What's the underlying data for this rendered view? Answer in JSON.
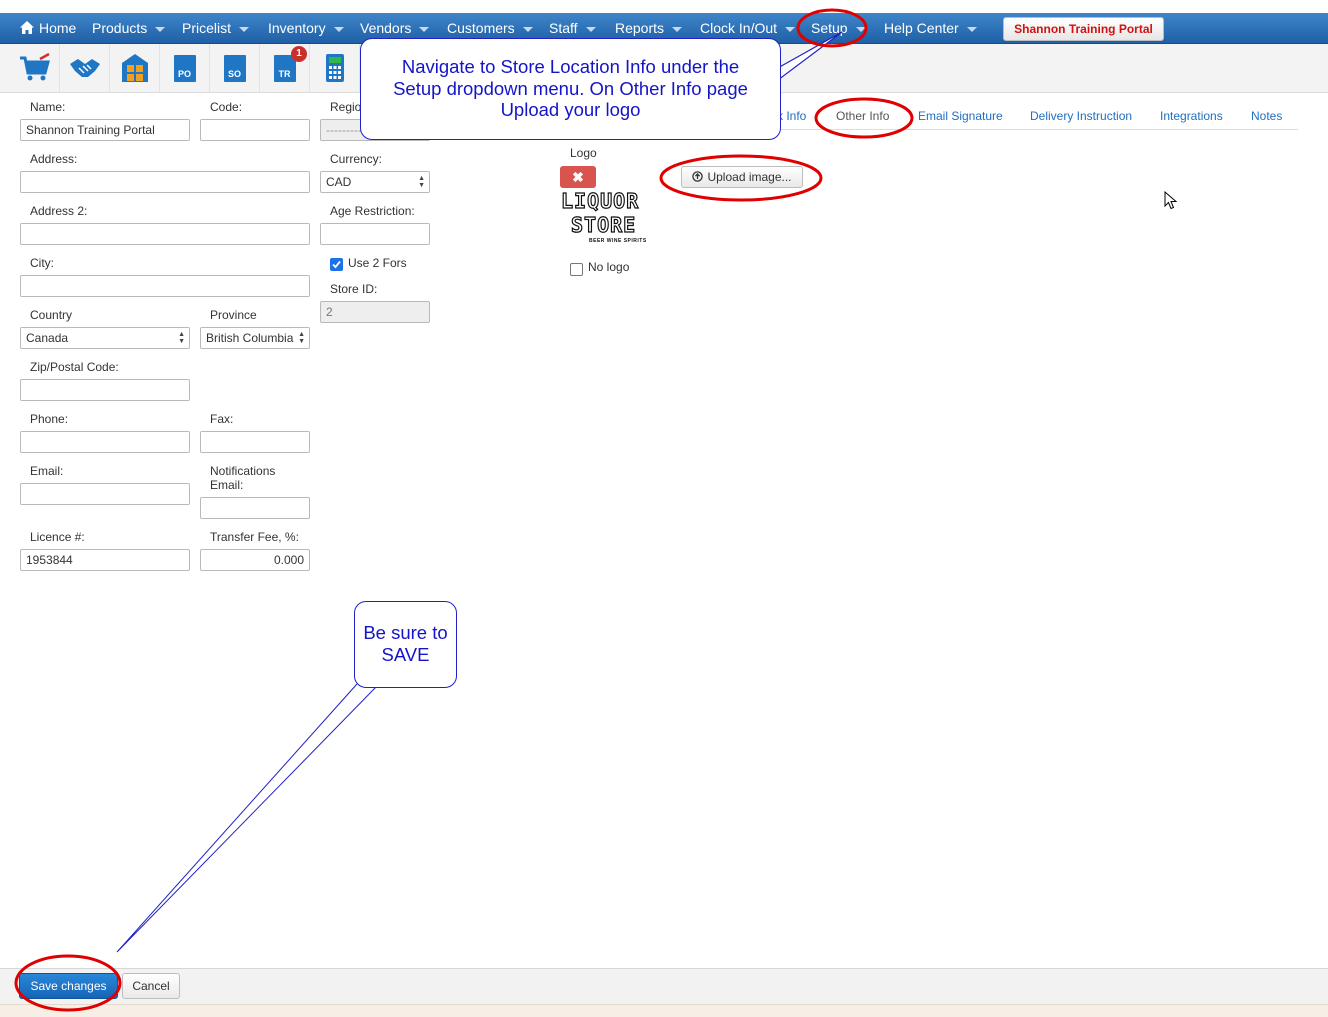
{
  "nav": {
    "home": "Home",
    "products": "Products",
    "pricelist": "Pricelist",
    "inventory": "Inventory",
    "vendors": "Vendors",
    "customers": "Customers",
    "staff": "Staff",
    "reports": "Reports",
    "clock": "Clock In/Out",
    "setup": "Setup",
    "help": "Help Center",
    "portal": "Shannon Training Portal"
  },
  "toolbar": {
    "tools": [
      "shopping-cart-icon",
      "handshake-icon",
      "store-grid-icon",
      "po-icon",
      "so-icon",
      "tr-icon",
      "calculator-icon"
    ],
    "po_label": "PO",
    "so_label": "SO",
    "tr_label": "TR",
    "tr_badge": "1"
  },
  "form": {
    "name_label": "Name:",
    "name_value": "Shannon Training Portal",
    "code_label": "Code:",
    "code_value": "",
    "region_label": "Regio",
    "region_value": "---------",
    "address_label": "Address:",
    "address_value": "",
    "currency_label": "Currency:",
    "currency_value": "CAD",
    "address2_label": "Address 2:",
    "address2_value": "",
    "age_label": "Age Restriction:",
    "age_value": "",
    "city_label": "City:",
    "city_value": "",
    "use2fors_label": "Use 2 Fors",
    "use2fors_checked": true,
    "storeid_label": "Store ID:",
    "storeid_value": "2",
    "country_label": "Country",
    "country_value": "Canada",
    "province_label": "Province",
    "province_value": "British Columbia",
    "zip_label": "Zip/Postal Code:",
    "zip_value": "",
    "phone_label": "Phone:",
    "phone_value": "",
    "fax_label": "Fax:",
    "fax_value": "",
    "email_label": "Email:",
    "email_value": "",
    "notif_label1": "Notifications",
    "notif_label2": "Email:",
    "notif_value": "",
    "licence_label": "Licence #:",
    "licence_value": "1953844",
    "transfer_label": "Transfer Fee, %:",
    "transfer_value": "0.000"
  },
  "tabs": {
    "partial": "k Info",
    "other": "Other Info",
    "email_sig": "Email Signature",
    "delivery": "Delivery Instruction",
    "integrations": "Integrations",
    "notes": "Notes"
  },
  "logo": {
    "label": "Logo",
    "delete_glyph": "✖",
    "upload_label": "Upload image...",
    "logo_line1": "LIQUOR",
    "logo_line2": "STORE",
    "logo_line3": "BEER WINE SPIRITS",
    "nologo_label": "No logo",
    "nologo_checked": false
  },
  "annotations": {
    "callout1_line1": "Navigate to Store Location Info under the",
    "callout1_line2": "Setup dropdown menu. On Other Info page",
    "callout1_line3": "Upload your logo",
    "callout2_line1": "Be sure to",
    "callout2_line2": "SAVE",
    "color": "#2020c8",
    "circle_color": "#e00000"
  },
  "footer": {
    "save": "Save changes",
    "cancel": "Cancel"
  },
  "colors": {
    "nav_bg": "#2a6db5",
    "link": "#1f6fc2",
    "danger": "#d9534f",
    "primary": "#1a6fc4"
  }
}
